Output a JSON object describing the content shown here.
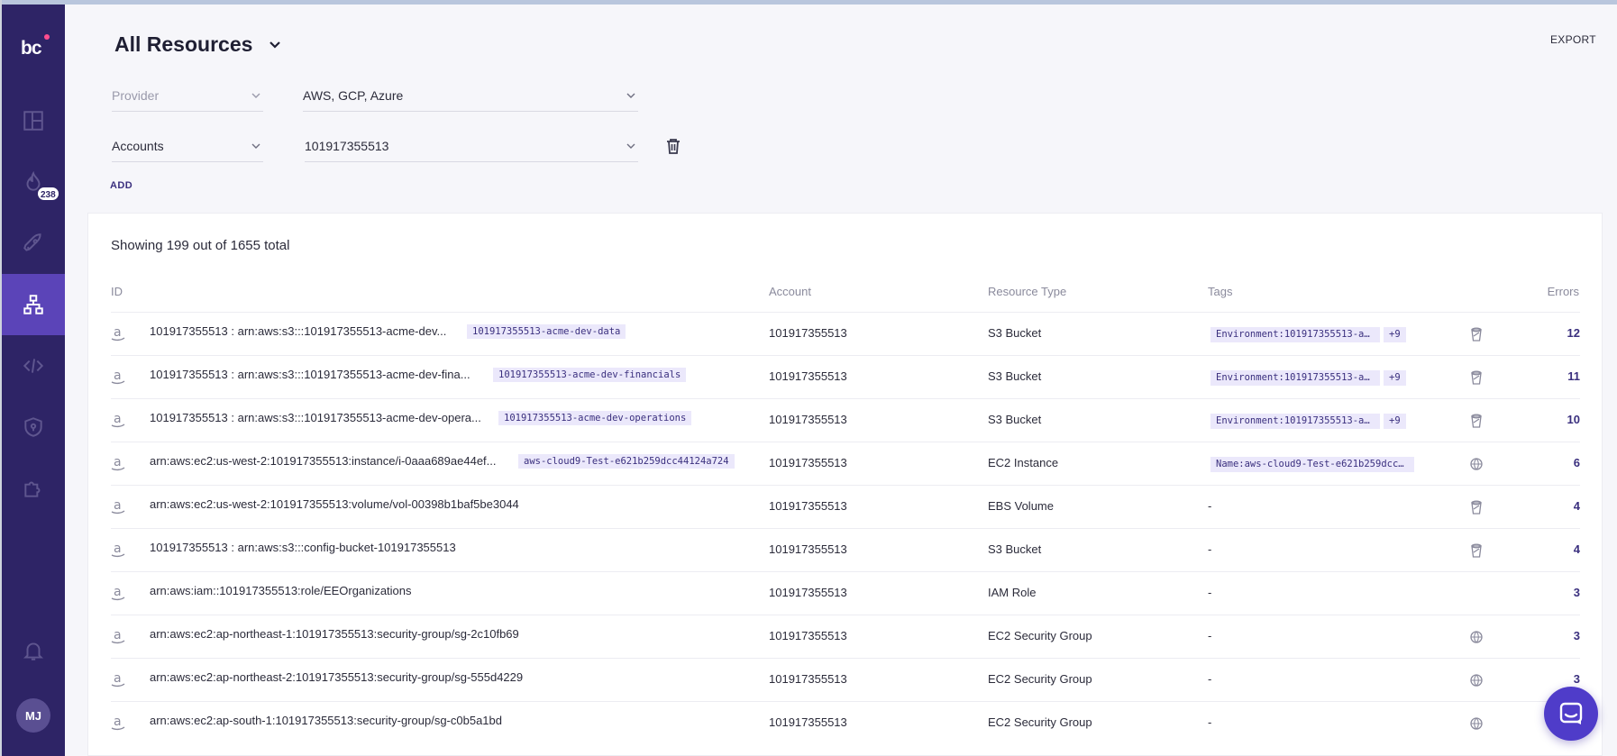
{
  "sidebar": {
    "logo": "bc",
    "badge": "238",
    "avatar": "MJ",
    "items": [
      {
        "icon": "dashboard-icon"
      },
      {
        "icon": "fire-icon"
      },
      {
        "icon": "rocket-icon"
      },
      {
        "icon": "resources-icon",
        "active": true
      },
      {
        "icon": "code-icon"
      },
      {
        "icon": "shield-icon"
      },
      {
        "icon": "puzzle-icon"
      },
      {
        "icon": "bell-icon"
      }
    ]
  },
  "header": {
    "title": "All Resources",
    "export_label": "EXPORT"
  },
  "filters": {
    "provider_label": "Provider",
    "provider_value": "AWS, GCP, Azure",
    "accounts_label": "Accounts",
    "accounts_value": "101917355513",
    "add_label": "ADD"
  },
  "table": {
    "showing": "Showing 199 out of 1655 total",
    "headers": {
      "id": "ID",
      "account": "Account",
      "resource_type": "Resource Type",
      "tags": "Tags",
      "errors": "Errors"
    },
    "rows": [
      {
        "id": "101917355513 : arn:aws:s3:::101917355513-acme-dev...",
        "chip": "101917355513-acme-dev-data",
        "account": "101917355513",
        "type": "S3 Bucket",
        "tag": "Environment:101917355513-a...",
        "tag_more": "+9",
        "icon": "bucket-icon",
        "errors": "12"
      },
      {
        "id": "101917355513 : arn:aws:s3:::101917355513-acme-dev-fina...",
        "chip": "101917355513-acme-dev-financials",
        "account": "101917355513",
        "type": "S3 Bucket",
        "tag": "Environment:101917355513-a...",
        "tag_more": "+9",
        "icon": "bucket-icon",
        "errors": "11"
      },
      {
        "id": "101917355513 : arn:aws:s3:::101917355513-acme-dev-opera...",
        "chip": "101917355513-acme-dev-operations",
        "account": "101917355513",
        "type": "S3 Bucket",
        "tag": "Environment:101917355513-a...",
        "tag_more": "+9",
        "icon": "bucket-icon",
        "errors": "10"
      },
      {
        "id": "arn:aws:ec2:us-west-2:101917355513:instance/i-0aaa689ae44ef...",
        "chip": "aws-cloud9-Test-e621b259dcc44124a724",
        "account": "101917355513",
        "type": "EC2 Instance",
        "tag": "Name:aws-cloud9-Test-e621b259dcc...",
        "tag_more": "",
        "icon": "network-icon",
        "errors": "6"
      },
      {
        "id": "arn:aws:ec2:us-west-2:101917355513:volume/vol-00398b1baf5be3044",
        "chip": "",
        "account": "101917355513",
        "type": "EBS Volume",
        "tag": "",
        "tag_more": "",
        "dash": "-",
        "icon": "bucket-icon",
        "errors": "4"
      },
      {
        "id": "101917355513 : arn:aws:s3:::config-bucket-101917355513",
        "chip": "",
        "account": "101917355513",
        "type": "S3 Bucket",
        "tag": "",
        "tag_more": "",
        "dash": "-",
        "icon": "bucket-icon",
        "errors": "4"
      },
      {
        "id": "arn:aws:iam::101917355513:role/EEOrganizations",
        "chip": "",
        "account": "101917355513",
        "type": "IAM Role",
        "tag": "",
        "tag_more": "",
        "dash": "-",
        "icon": "",
        "errors": "3"
      },
      {
        "id": "arn:aws:ec2:ap-northeast-1:101917355513:security-group/sg-2c10fb69",
        "chip": "",
        "account": "101917355513",
        "type": "EC2 Security Group",
        "tag": "",
        "tag_more": "",
        "dash": "-",
        "icon": "network-icon",
        "errors": "3"
      },
      {
        "id": "arn:aws:ec2:ap-northeast-2:101917355513:security-group/sg-555d4229",
        "chip": "",
        "account": "101917355513",
        "type": "EC2 Security Group",
        "tag": "",
        "tag_more": "",
        "dash": "-",
        "icon": "network-icon",
        "errors": "3"
      },
      {
        "id": "arn:aws:ec2:ap-south-1:101917355513:security-group/sg-c0b5a1bd",
        "chip": "",
        "account": "101917355513",
        "type": "EC2 Security Group",
        "tag": "",
        "tag_more": "",
        "dash": "-",
        "icon": "network-icon",
        "errors": ""
      }
    ]
  },
  "chat": {
    "icon": "chat-icon"
  }
}
